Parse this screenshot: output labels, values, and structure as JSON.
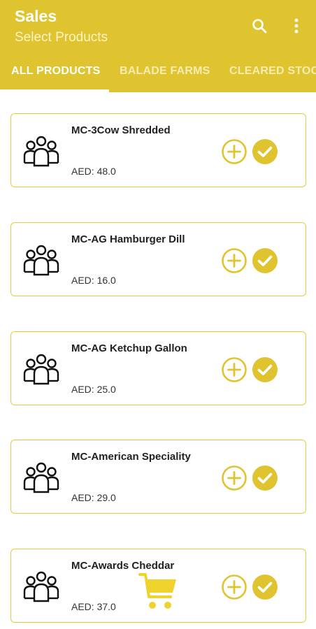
{
  "header": {
    "title": "Sales",
    "subtitle": "Select Products",
    "search_icon": "search-icon",
    "more_icon": "more-vertical-icon"
  },
  "tabs": [
    {
      "label": "ALL PRODUCTS",
      "active": true
    },
    {
      "label": "BALADE FARMS",
      "active": false
    },
    {
      "label": "CLEARED STOC",
      "active": false
    }
  ],
  "products": [
    {
      "name": "MC-3Cow Shredded",
      "price": "AED:  48.0"
    },
    {
      "name": "MC-AG Hamburger Dill",
      "price": "AED:  16.0"
    },
    {
      "name": "MC-AG Ketchup Gallon",
      "price": "AED:  25.0"
    },
    {
      "name": "MC-American Speciality",
      "price": "AED:  29.0"
    },
    {
      "name": "MC-Awards Cheddar",
      "price": "AED:  37.0"
    }
  ],
  "icons": {
    "product": "group-icon",
    "add": "add-circle-icon",
    "check": "check-circle-icon",
    "cart": "cart-icon"
  },
  "colors": {
    "accent": "#DFC430",
    "card_border": "#E3CD45",
    "text": "#222222"
  }
}
